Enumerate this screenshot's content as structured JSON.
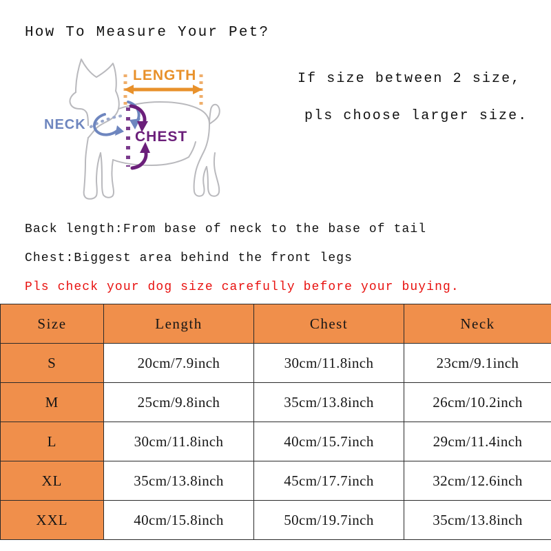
{
  "title": "How To Measure Your Pet?",
  "note": {
    "line1": "If size between 2 size,",
    "line2": "pls choose larger size."
  },
  "diagram": {
    "length_label": "LENGTH",
    "neck_label": "NECK",
    "chest_label": "CHEST",
    "colors": {
      "dog_outline": "#b9b9bd",
      "length": "#E8912B",
      "neck": "#6E86BF",
      "chest": "#6B1F7A"
    }
  },
  "descriptions": [
    "Back length:From base of neck to the base of tail",
    "Chest:Biggest area behind the front legs"
  ],
  "warning": "Pls check your dog size carefully before your buying.",
  "table": {
    "accent_color": "#F08F4B",
    "headers": [
      "Size",
      "Length",
      "Chest",
      "Neck"
    ],
    "rows": [
      {
        "size": "S",
        "length": "20cm/7.9inch",
        "chest": "30cm/11.8inch",
        "neck": "23cm/9.1inch"
      },
      {
        "size": "M",
        "length": "25cm/9.8inch",
        "chest": "35cm/13.8inch",
        "neck": "26cm/10.2inch"
      },
      {
        "size": "L",
        "length": "30cm/11.8inch",
        "chest": "40cm/15.7inch",
        "neck": "29cm/11.4inch"
      },
      {
        "size": "XL",
        "length": "35cm/13.8inch",
        "chest": "45cm/17.7inch",
        "neck": "32cm/12.6inch"
      },
      {
        "size": "XXL",
        "length": "40cm/15.8inch",
        "chest": "50cm/19.7inch",
        "neck": "35cm/13.8inch"
      }
    ]
  }
}
